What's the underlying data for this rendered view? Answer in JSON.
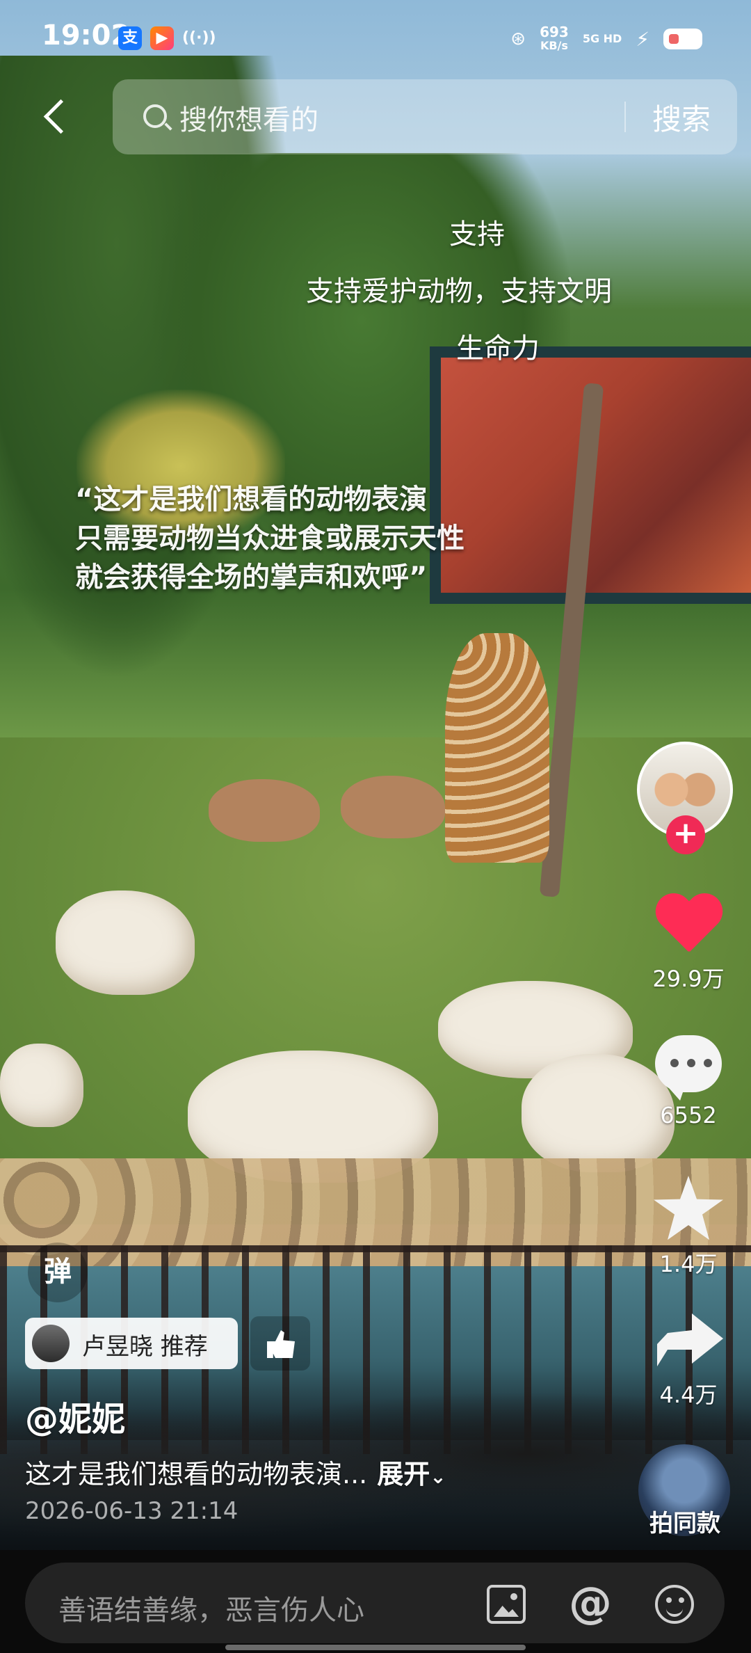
{
  "status_bar": {
    "time": "19:02",
    "speed_value": "693",
    "speed_unit": "KB/s",
    "network": "5G HD",
    "icons": [
      "alipay-icon",
      "video-app-icon",
      "hotspot-icon",
      "nfc-icon",
      "signal-icon",
      "charging-icon",
      "battery-icon"
    ]
  },
  "search": {
    "placeholder": "搜你想看的",
    "button_label": "搜索"
  },
  "danmaku": {
    "line1": "支持",
    "line2": "支持爱护动物，支持文明",
    "line3": "生命力"
  },
  "video_caption": {
    "line1": "“这才是我们想看的动物表演",
    "line2": "只需要动物当众进食或展示天性",
    "line3": "就会获得全场的掌声和欢呼”"
  },
  "actions": {
    "like_count": "29.9万",
    "comment_count": "6552",
    "favorite_count": "1.4万",
    "share_count": "4.4万",
    "same_style_label": "拍同款",
    "follow_symbol": "+"
  },
  "info": {
    "danmu_label": "弹",
    "recommend_text": "卢昱晓 推荐",
    "author": "@妮妮",
    "description": "这才是我们想看的动物表演...",
    "expand_label": "展开",
    "date": "2026-06-13 21:14"
  },
  "comment_bar": {
    "placeholder": "善语结善缘，恶言伤人心",
    "at_symbol": "@"
  },
  "colors": {
    "like": "#fe2c55",
    "follow": "#f02a56",
    "bottom_bar": "#0b0b0b"
  }
}
